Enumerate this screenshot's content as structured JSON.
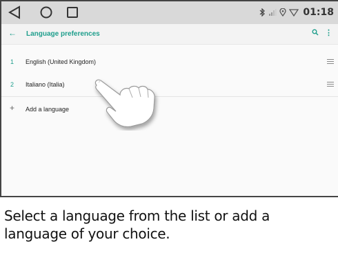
{
  "status_bar": {
    "time": "01:18",
    "icons": [
      "bluetooth-icon",
      "signal-icon",
      "location-icon",
      "wifi-icon"
    ]
  },
  "navigation": {
    "buttons": [
      "back-triangle-icon",
      "home-circle-icon",
      "recent-square-icon"
    ]
  },
  "app_bar": {
    "title": "Language preferences",
    "back_icon": "←",
    "search_icon": "⚲",
    "menu_icon": "⋮"
  },
  "languages": [
    {
      "index": "1",
      "label": "English (United Kingdom)"
    },
    {
      "index": "2",
      "label": "Italiano (Italia)"
    }
  ],
  "add_language": {
    "icon": "+",
    "label": "Add a language"
  },
  "caption": "Select a language from the list or add a language of your choice.",
  "colors": {
    "accent": "#1e9e8c",
    "status_bar": "#d9d9d9",
    "app_bar": "#f3f3f3"
  }
}
